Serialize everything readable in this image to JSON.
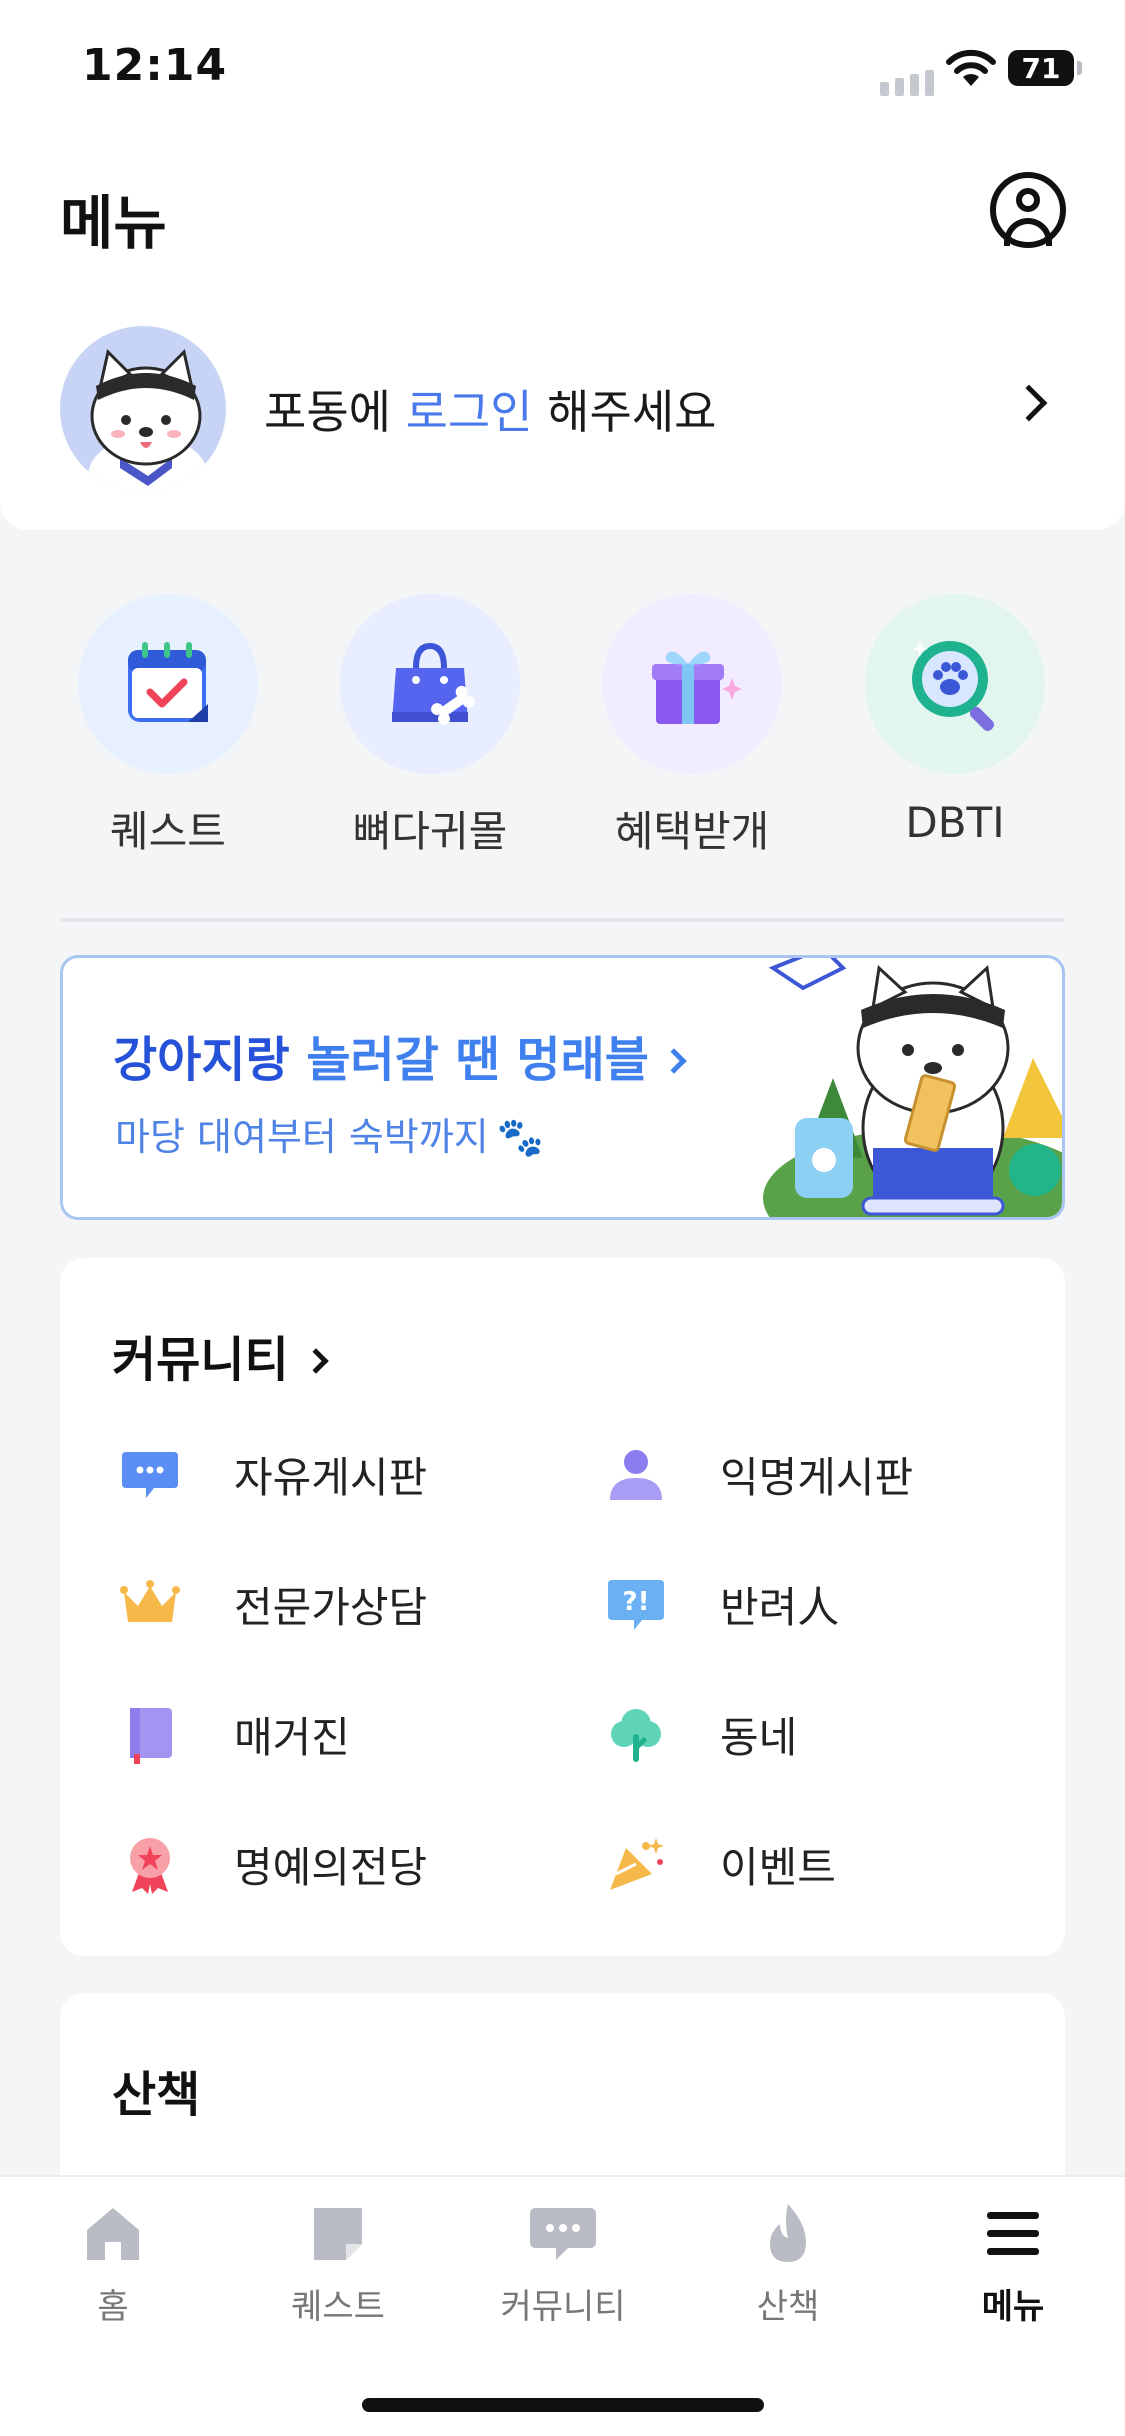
{
  "status_bar": {
    "time": "12:14",
    "battery": "71"
  },
  "header": {
    "title": "메뉴",
    "profile_icon": "person-circle-icon"
  },
  "login": {
    "prefix": "포동에 ",
    "link": "로그인",
    "suffix": " 해주세요"
  },
  "quick_menu": [
    {
      "label": "퀘스트",
      "icon": "calendar-check-icon",
      "bg": "#e6f0ff"
    },
    {
      "label": "뼈다귀몰",
      "icon": "shopping-bag-icon",
      "bg": "#e8eeff"
    },
    {
      "label": "혜택받개",
      "icon": "gift-icon",
      "bg": "#f1ecff"
    },
    {
      "label": "DBTI",
      "icon": "paw-search-icon",
      "bg": "#e2f6ef"
    }
  ],
  "banner": {
    "title_part1": "강아지랑 ",
    "title_part2": "놀러갈 땐 멍래블",
    "subtitle": "마당 대여부터 숙박까지"
  },
  "community": {
    "title": "커뮤니티",
    "items": [
      {
        "label": "자유게시판",
        "icon": "chat-bubble-icon"
      },
      {
        "label": "익명게시판",
        "icon": "person-icon"
      },
      {
        "label": "전문가상담",
        "icon": "crown-icon"
      },
      {
        "label": "반려人",
        "icon": "question-bubble-icon"
      },
      {
        "label": "매거진",
        "icon": "book-icon"
      },
      {
        "label": "동네",
        "icon": "tree-icon"
      },
      {
        "label": "명예의전당",
        "icon": "medal-icon"
      },
      {
        "label": "이벤트",
        "icon": "party-popper-icon"
      }
    ]
  },
  "walk": {
    "title": "산책"
  },
  "tab_bar": {
    "items": [
      {
        "label": "홈",
        "icon": "home-icon",
        "active": false
      },
      {
        "label": "퀘스트",
        "icon": "note-icon",
        "active": false
      },
      {
        "label": "커뮤니티",
        "icon": "chat-icon",
        "active": false
      },
      {
        "label": "산책",
        "icon": "flame-icon",
        "active": false
      },
      {
        "label": "메뉴",
        "icon": "menu-icon",
        "active": true
      }
    ]
  },
  "colors": {
    "accent_blue": "#4a79ec",
    "banner_title": "#2552d8",
    "background": "#f4f5f7"
  }
}
